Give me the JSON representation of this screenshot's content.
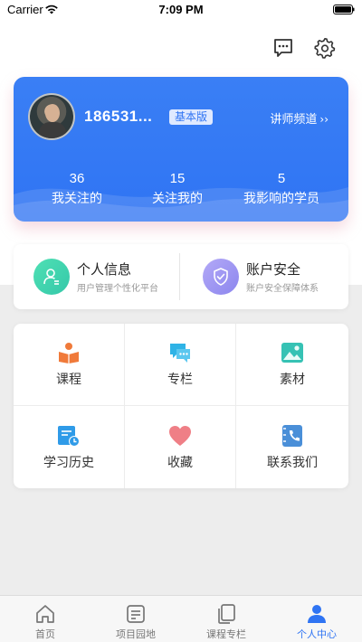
{
  "status_bar": {
    "carrier": "Carrier",
    "time": "7:09 PM"
  },
  "top_actions": {
    "message_icon": "message-icon",
    "settings_icon": "gear-icon"
  },
  "profile": {
    "username": "186531...",
    "plan": "基本版",
    "channel_link": "讲师频道",
    "channel_chevron": "››",
    "stats": [
      {
        "value": "36",
        "label": "我关注的"
      },
      {
        "value": "15",
        "label": "关注我的"
      },
      {
        "value": "5",
        "label": "我影响的学员"
      }
    ]
  },
  "info": [
    {
      "title": "个人信息",
      "subtitle": "用户管理个性化平台",
      "icon": "user-icon"
    },
    {
      "title": "账户安全",
      "subtitle": "账户安全保障体系",
      "icon": "shield-icon"
    }
  ],
  "grid": [
    {
      "label": "课程",
      "icon": "reading-icon",
      "color": "#f07a3a"
    },
    {
      "label": "专栏",
      "icon": "chat-bubbles-icon",
      "color": "#2fb3e6"
    },
    {
      "label": "素材",
      "icon": "image-icon",
      "color": "#36c2b4"
    },
    {
      "label": "学习历史",
      "icon": "history-icon",
      "color": "#2f9be8"
    },
    {
      "label": "收藏",
      "icon": "heart-icon",
      "color": "#ef7f86"
    },
    {
      "label": "联系我们",
      "icon": "phone-book-icon",
      "color": "#4a8fd8"
    }
  ],
  "tabs": [
    {
      "label": "首页",
      "icon": "home-icon",
      "active": false
    },
    {
      "label": "项目园地",
      "icon": "document-icon",
      "active": false
    },
    {
      "label": "课程专栏",
      "icon": "copy-icon",
      "active": false
    },
    {
      "label": "个人中心",
      "icon": "person-icon",
      "active": true
    }
  ],
  "colors": {
    "accent": "#2f74f3",
    "card_blue": "#3a7ff5",
    "tab_inactive": "#777777"
  }
}
